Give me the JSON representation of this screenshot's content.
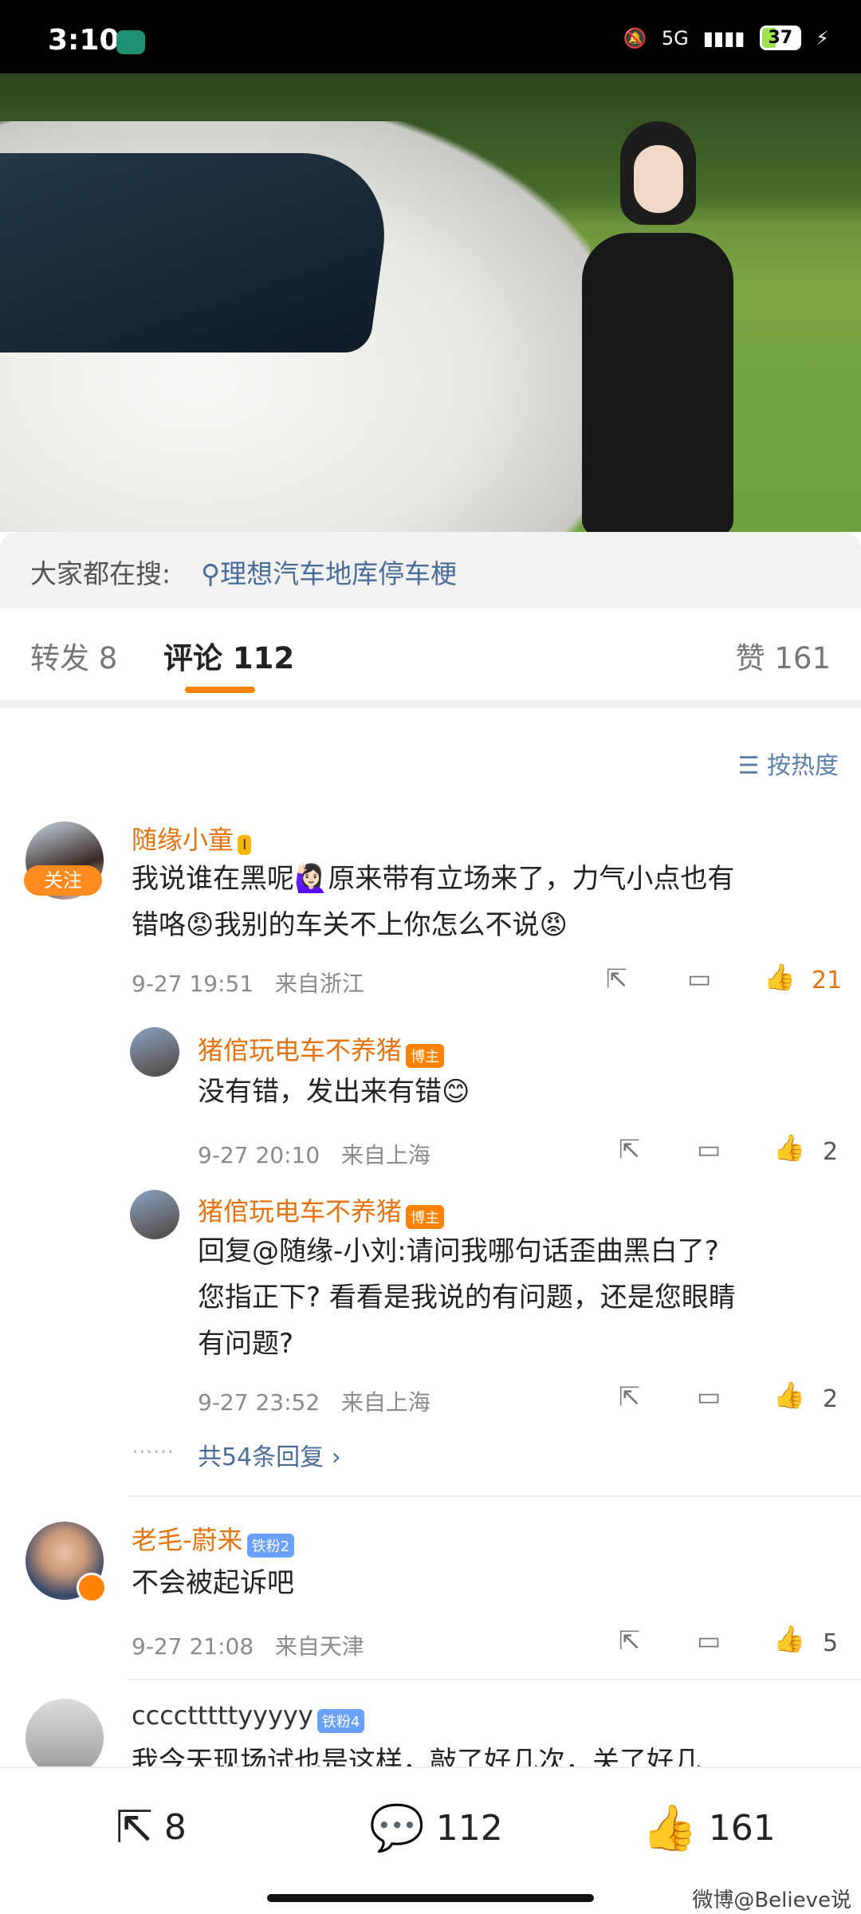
{
  "status_bar": {
    "time": "3:10",
    "network": "5G",
    "battery": "37"
  },
  "search_suggestion": {
    "label": "大家都在搜:",
    "icon": "search-icon",
    "term": "理想汽车地库停车梗"
  },
  "tabs": {
    "repost": "转发 8",
    "comments": "评论 112",
    "likes": "赞 161"
  },
  "sort": {
    "label": "按热度",
    "icon": "sort-icon"
  },
  "comments": [
    {
      "user": "随缘小童",
      "badge": "I",
      "follow_label": "关注",
      "text_line1": "我说谁在黑呢🙋🏻‍♀️原来带有立场来了，力气小点也有",
      "text_line2": "错咯😡我别的车关不上你怎么不说😡",
      "time": "9-27 19:51",
      "location": "来自浙江",
      "likes": "21",
      "replies": [
        {
          "user": "猪倌玩电车不养猪",
          "badge": "博主",
          "text_line1": "没有错，发出来有错😊",
          "text_line2": "",
          "text_line3": "",
          "time": "9-27 20:10",
          "location": "来自上海",
          "likes": "2"
        },
        {
          "user": "猪倌玩电车不养猪",
          "badge": "博主",
          "text_line1": "回复@随缘-小刘:请问我哪句话歪曲黑白了?",
          "text_line2": "您指正下? 看看是我说的有问题，还是您眼睛",
          "text_line3": "有问题?",
          "time": "9-27 23:52",
          "location": "来自上海",
          "likes": "2"
        }
      ],
      "more_replies": "共54条回复 ›"
    },
    {
      "user": "老毛-蔚来",
      "badge": "铁粉2",
      "text": "不会被起诉吧",
      "time": "9-27 21:08",
      "location": "来自天津",
      "likes": "5"
    },
    {
      "user": "cccctttttyyyyy",
      "badge": "铁粉4",
      "text": "我今天现场试也是这样，敲了好几次，关了好几"
    }
  ],
  "bottom_bar": {
    "repost": "8",
    "comments": "112",
    "likes": "161"
  },
  "watermark": "微博@Believe说"
}
